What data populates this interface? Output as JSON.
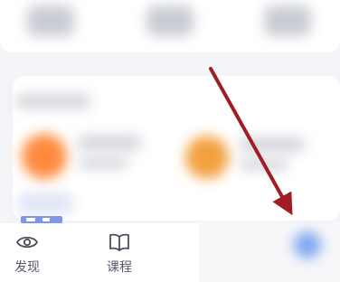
{
  "bottom_nav": {
    "items": [
      {
        "label": "发现",
        "icon": "eye-icon"
      },
      {
        "label": "课程",
        "icon": "book-icon"
      }
    ]
  },
  "colors": {
    "arrow": "#a01e23",
    "accent_orange": "#ff8a3d",
    "accent_blue": "#7da6f0"
  }
}
